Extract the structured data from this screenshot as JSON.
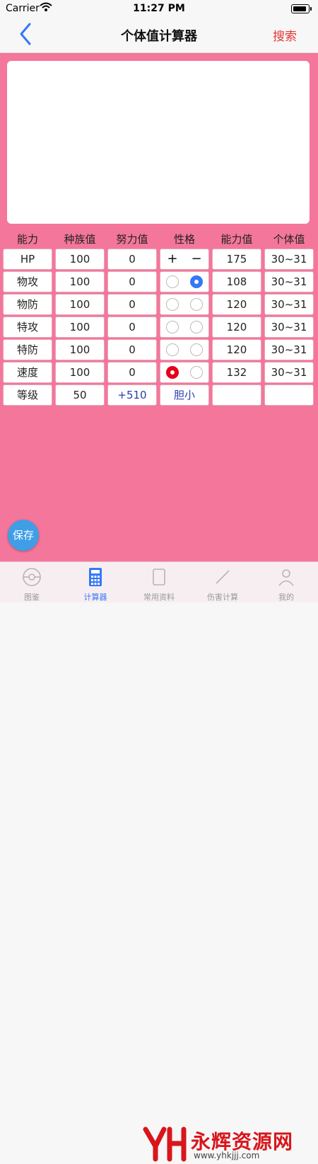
{
  "status_bar": {
    "carrier": "Carrier",
    "time": "11:27 PM"
  },
  "navbar": {
    "title": "个体值计算器",
    "search_label": "搜索"
  },
  "table": {
    "headers": [
      "能力",
      "种族值",
      "努力值",
      "性格",
      "能力值",
      "个体值"
    ],
    "hp_row": {
      "stat": "HP",
      "base": "100",
      "effort": "0",
      "plus": "+",
      "minus": "−",
      "value": "175",
      "iv": "30~31"
    },
    "rows": [
      {
        "stat": "物攻",
        "base": "100",
        "effort": "0",
        "nature_up": false,
        "nature_down": true,
        "value": "108",
        "iv": "30~31"
      },
      {
        "stat": "物防",
        "base": "100",
        "effort": "0",
        "nature_up": false,
        "nature_down": false,
        "value": "120",
        "iv": "30~31"
      },
      {
        "stat": "特攻",
        "base": "100",
        "effort": "0",
        "nature_up": false,
        "nature_down": false,
        "value": "120",
        "iv": "30~31"
      },
      {
        "stat": "特防",
        "base": "100",
        "effort": "0",
        "nature_up": false,
        "nature_down": false,
        "value": "120",
        "iv": "30~31"
      },
      {
        "stat": "速度",
        "base": "100",
        "effort": "0",
        "nature_up": true,
        "nature_down": false,
        "value": "132",
        "iv": "30~31"
      }
    ],
    "level_row": {
      "label": "等级",
      "level": "50",
      "effort_total": "+510",
      "nature": "胆小",
      "value": "",
      "iv": ""
    }
  },
  "save_button": "保存",
  "tabbar": {
    "tabs": [
      {
        "label": "图鉴",
        "icon": "pokeball-icon",
        "active": false
      },
      {
        "label": "计算器",
        "icon": "calculator-icon",
        "active": true
      },
      {
        "label": "常用资料",
        "icon": "book-icon",
        "active": false
      },
      {
        "label": "伤害计算",
        "icon": "sword-icon",
        "active": false
      },
      {
        "label": "我的",
        "icon": "user-icon",
        "active": false
      }
    ]
  },
  "watermark": {
    "text": "永辉资源网",
    "url": "www.yhkjjj.com"
  },
  "colors": {
    "background": "#f4769b",
    "accent": "#3478f6",
    "nature_up": "#e3001b",
    "search": "#e53935"
  }
}
